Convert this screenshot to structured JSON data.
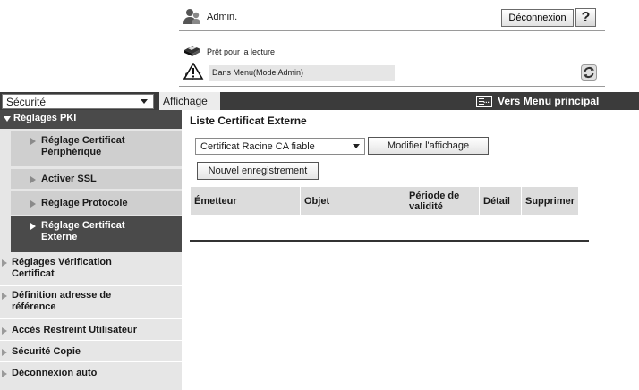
{
  "header": {
    "user": "Admin.",
    "logout_label": "Déconnexion",
    "help_label": "?",
    "status_ready": "Prêt pour la lecture",
    "status_mode": "Dans Menu(Mode Admin)"
  },
  "topbar": {
    "security_select": "Sécurité",
    "tab_display": "Affichage",
    "main_menu": "Vers Menu principal"
  },
  "sidebar": {
    "items": [
      {
        "label": "Réglages PKI"
      },
      {
        "label": "Réglage Certificat Périphérique"
      },
      {
        "label": "Activer SSL"
      },
      {
        "label": "Réglage Protocole"
      },
      {
        "label": "Réglage Certificat Externe"
      },
      {
        "label": "Réglages Vérification Certificat"
      },
      {
        "label": "Définition adresse de référence"
      },
      {
        "label": "Accès Restreint Utilisateur"
      },
      {
        "label": "Sécurité Copie"
      },
      {
        "label": "Déconnexion auto"
      }
    ]
  },
  "main": {
    "title": "Liste Certificat Externe",
    "filter_value": "Certificat Racine CA fiable",
    "modify_label": "Modifier l'affichage",
    "new_label": "Nouvel enregistrement",
    "columns": [
      "Émetteur",
      "Objet",
      "Période de validité",
      "Détail",
      "Supprimer"
    ]
  },
  "colors": {
    "band": "#3b3b3b",
    "sidebar_bg": "#e6e6e6",
    "sidebar_sub": "#cfcfcf",
    "active": "#4a4a4a",
    "table_header": "#dcdcdc"
  },
  "icons": {
    "user": "admin-user-icon",
    "printer": "printer-icon",
    "warning": "warning-icon",
    "refresh": "refresh-icon",
    "menu": "main-menu-icon"
  }
}
